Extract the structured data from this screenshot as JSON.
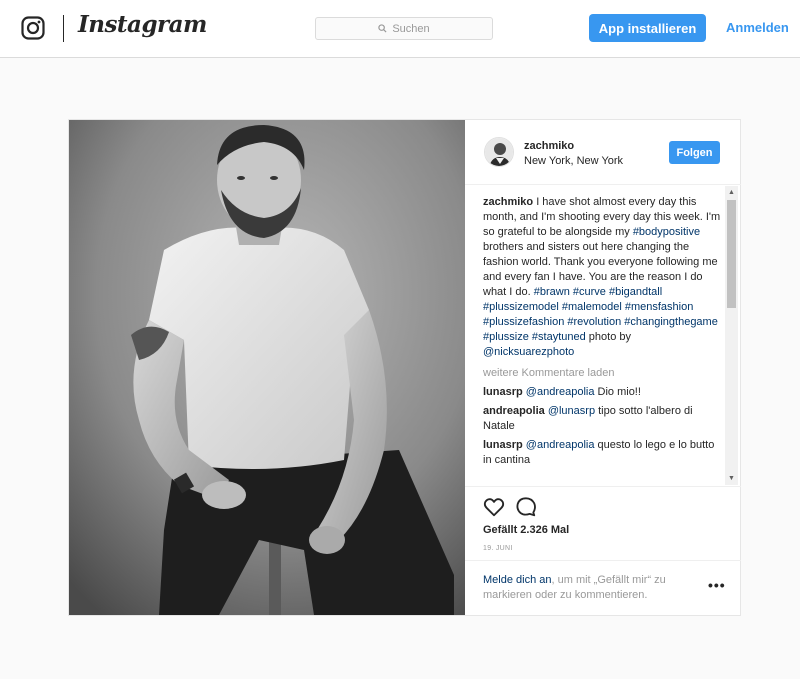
{
  "header": {
    "wordmark": "Instagram",
    "search_placeholder": "Suchen",
    "install_label": "App installieren",
    "login_label": "Anmelden"
  },
  "post": {
    "username": "zachmiko",
    "location": "New York, New York",
    "follow_label": "Folgen",
    "caption": {
      "username": "zachmiko",
      "text_1": " I have shot almost every day this month, and I'm shooting every day this week. I'm so grateful to be alongside my ",
      "tag_1": "#bodypositive",
      "text_2": " brothers and sisters out here changing the fashion world. Thank you everyone following me and every fan I have. You are the reason I do what I do. ",
      "tags": "#brawn #curve #bigandtall #plussizemodel #malemodel #mensfashion #plussizefashion #revolution #changingthegame #plussize #staytuned",
      "text_3": " photo by ",
      "mention": "@nicksuarezphoto"
    },
    "load_more": "weitere Kommentare laden",
    "comments": [
      {
        "user": "lunasrp",
        "mention": "@andreapolia",
        "text": " Dio mio!!"
      },
      {
        "user": "andreapolia",
        "mention": "@lunasrp",
        "text": " tipo sotto l'albero di Natale"
      },
      {
        "user": "lunasrp",
        "mention": "@andreapolia",
        "text": " questo lo lego e lo butto in cantina"
      }
    ],
    "likes": "Gefällt 2.326 Mal",
    "date": "19. JUNI",
    "login_prompt": {
      "link": "Melde dich an",
      "text": ", um mit „Gefällt mir“ zu markieren oder zu kommentieren."
    },
    "more_options": "•••"
  },
  "colors": {
    "accent": "#3897f0",
    "link": "#003569",
    "muted": "#999999",
    "border": "#dbdbdb"
  },
  "icons": [
    "instagram-camera-icon",
    "search-icon",
    "heart-icon",
    "comment-icon",
    "more-options-icon"
  ]
}
